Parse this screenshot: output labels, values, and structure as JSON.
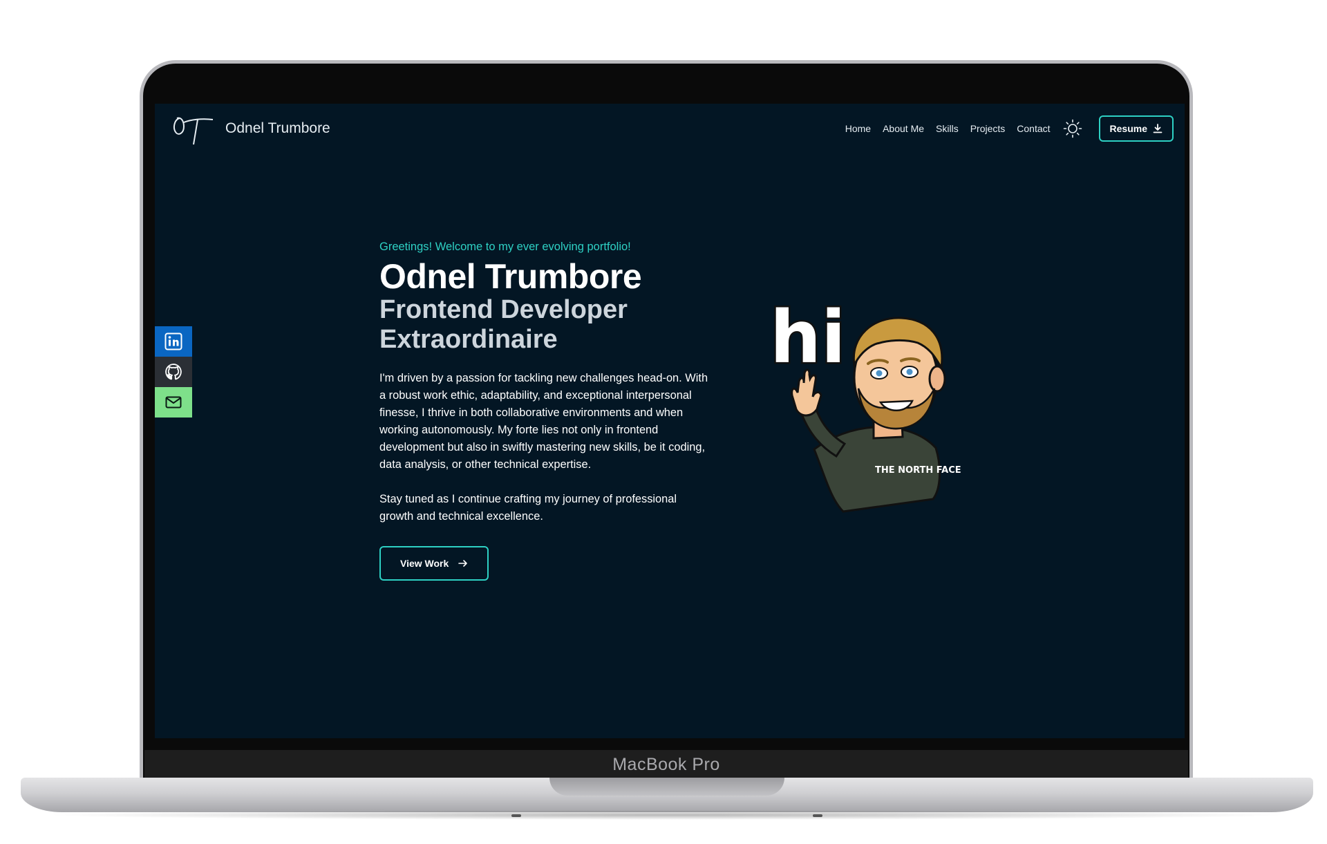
{
  "device": {
    "label": "MacBook Pro"
  },
  "nav": {
    "brand_name": "Odnel Trumbore",
    "links": [
      "Home",
      "About Me",
      "Skills",
      "Projects",
      "Contact"
    ],
    "resume_label": "Resume",
    "logo_icon": "signature-logo-icon",
    "theme_icon": "sun-icon",
    "download_icon": "download-icon"
  },
  "socials": [
    {
      "name": "linkedin",
      "icon": "linkedin-icon",
      "color": "#0a66c2"
    },
    {
      "name": "github",
      "icon": "github-icon",
      "color": "#2b2f35"
    },
    {
      "name": "email",
      "icon": "mail-icon",
      "color": "#7ee08a"
    }
  ],
  "hero": {
    "greeting": "Greetings! Welcome to my ever evolving portfolio!",
    "name": "Odnel Trumbore",
    "role_line1": "Frontend Developer",
    "role_line2": "Extraordinaire",
    "body": "I'm driven by a passion for tackling new challenges head-on. With a robust work ethic, adaptability, and exceptional interpersonal finesse, I thrive in both collaborative environments and when working autonomously. My forte lies not only in frontend development but also in swiftly mastering new skills, be it coding, data analysis, or other technical expertise.",
    "body2": "Stay tuned as I continue crafting my journey of professional growth and technical excellence.",
    "cta_label": "View Work",
    "cta_icon": "arrow-right-icon",
    "avatar_image": "waving-avatar-illustration",
    "hi_text": "hi",
    "hoodie_text": "THE NORTH FACE"
  },
  "colors": {
    "background": "#031624",
    "accent": "#2ed1c4",
    "text": "#ffffff",
    "muted": "#cdd5dc"
  }
}
